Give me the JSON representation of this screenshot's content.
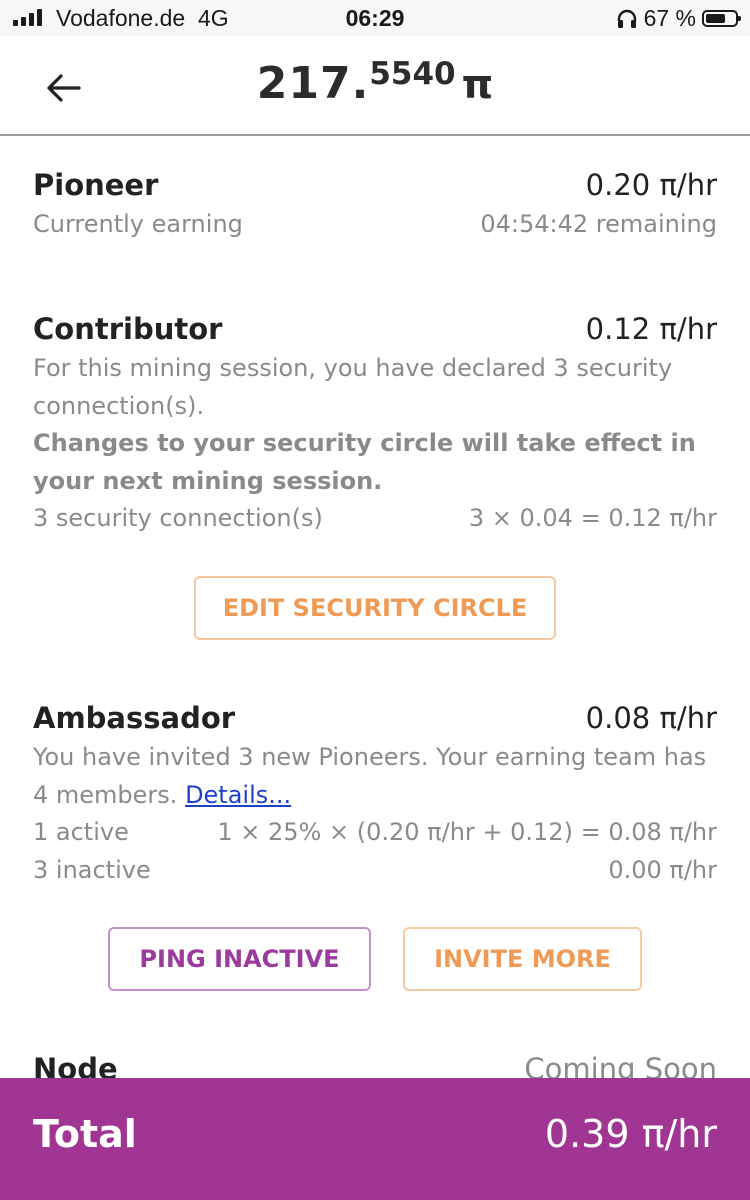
{
  "status_bar": {
    "carrier": "Vodafone.de",
    "network": "4G",
    "time": "06:29",
    "battery_percent": "67 %",
    "battery_level": 0.67
  },
  "header": {
    "balance_int": "217.",
    "balance_frac": "5540",
    "currency_symbol": "π"
  },
  "pioneer": {
    "title": "Pioneer",
    "rate": "0.20 π/hr",
    "subtitle": "Currently earning",
    "remaining": "04:54:42 remaining"
  },
  "contributor": {
    "title": "Contributor",
    "rate": "0.12 π/hr",
    "description": "For this mining session, you have declared 3 security connection(s).",
    "notice": "Changes to your security circle will take effect in your next mining session.",
    "connections_label": "3 security connection(s)",
    "connections_formula": "3 × 0.04 = 0.12 π/hr",
    "edit_button": "EDIT SECURITY CIRCLE"
  },
  "ambassador": {
    "title": "Ambassador",
    "rate": "0.08 π/hr",
    "description": "You have invited 3 new Pioneers. Your earning team has 4 members.",
    "details_link": "Details...",
    "active_label": "1 active",
    "active_formula": "1 × 25% × (0.20 π/hr + 0.12) = 0.08 π/hr",
    "inactive_label": "3 inactive",
    "inactive_value": "0.00 π/hr",
    "ping_button": "PING INACTIVE",
    "invite_button": "INVITE MORE"
  },
  "node": {
    "title": "Node",
    "status": "Coming Soon"
  },
  "total": {
    "label": "Total",
    "value": "0.39 π/hr"
  },
  "colors": {
    "accent_purple": "#a13593",
    "button_orange": "#ef9b56",
    "button_purple": "#9b3b9e",
    "link_blue": "#1f3fc8"
  },
  "icons": {
    "back": "arrow-left-icon",
    "signal": "signal-bars-icon",
    "headphones": "headphones-icon",
    "battery": "battery-icon"
  }
}
